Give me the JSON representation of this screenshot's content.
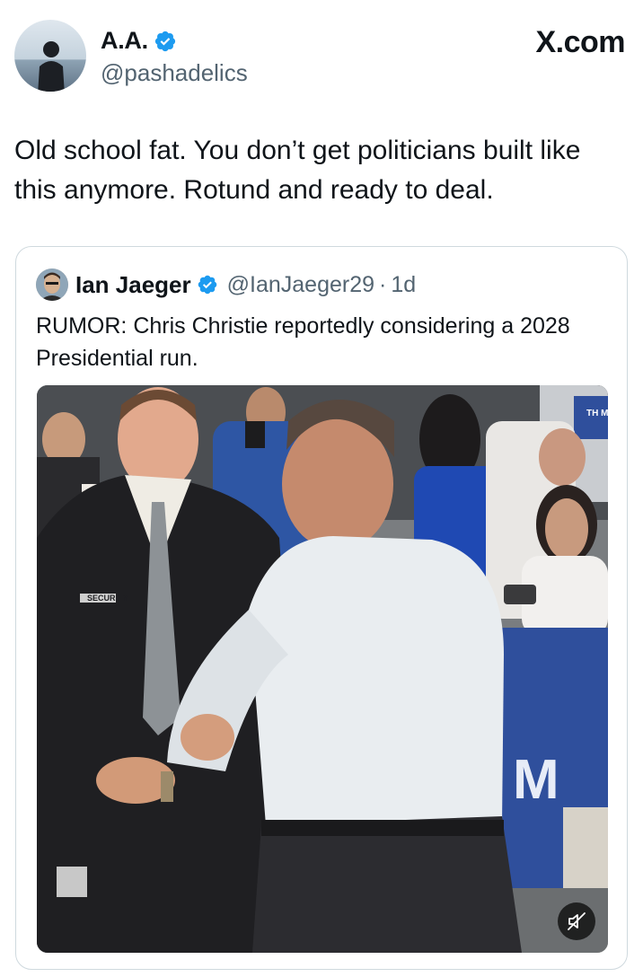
{
  "author": {
    "name": "A.A.",
    "handle": "@pashadelics",
    "verified": true
  },
  "source_label": "X.com",
  "tweet": {
    "text": "Old school fat. You don’t get politicians built like this anymore. Rotund and ready to deal."
  },
  "quoted_tweet": {
    "name": "Ian Jaeger",
    "handle": "@IanJaeger29",
    "separator": "·",
    "time": "1d",
    "verified": true,
    "text": "RUMOR: Chris Christie reportedly considering a 2028 Presidential run.",
    "media": {
      "type": "video",
      "photo_text": {
        "jacket_badge": "SECURITY",
        "banner": "M",
        "corner_sign": "TH MOS"
      },
      "mute_icon": "speaker-muted-icon"
    }
  },
  "colors": {
    "verified_blue": "#1d9bf0",
    "text": "#0f1419",
    "secondary_text": "#536471",
    "border": "#cfd9de",
    "banner_blue": "#2f4f9c"
  }
}
